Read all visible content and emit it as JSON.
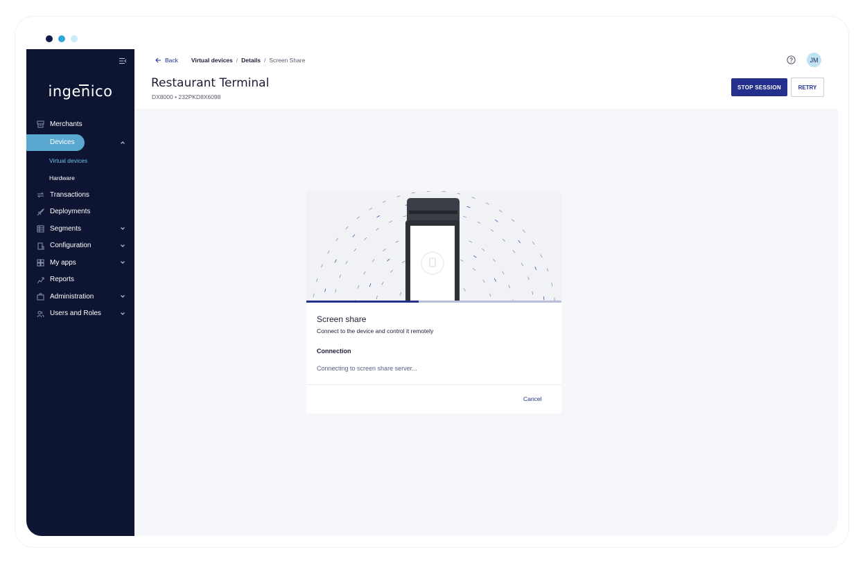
{
  "window": {
    "dots": [
      "#0d1a4a",
      "#2fa6db",
      "#c9ecf8"
    ]
  },
  "sidebar": {
    "logo": "ingenico",
    "items": [
      {
        "label": "Merchants",
        "icon": "store-icon",
        "expandable": false
      },
      {
        "label": "Devices",
        "icon": "device-icon",
        "expandable": true,
        "expanded": true,
        "active": true
      },
      {
        "label": "Transactions",
        "icon": "transfer-icon",
        "expandable": false
      },
      {
        "label": "Deployments",
        "icon": "rocket-icon",
        "expandable": false
      },
      {
        "label": "Segments",
        "icon": "segments-icon",
        "expandable": true
      },
      {
        "label": "Configuration",
        "icon": "configuration-icon",
        "expandable": true
      },
      {
        "label": "My apps",
        "icon": "apps-icon",
        "expandable": true
      },
      {
        "label": "Reports",
        "icon": "chart-icon",
        "expandable": false
      },
      {
        "label": "Administration",
        "icon": "briefcase-icon",
        "expandable": true
      },
      {
        "label": "Users and Roles",
        "icon": "users-icon",
        "expandable": true
      }
    ],
    "device_subitems": [
      {
        "label": "Virtual devices",
        "current": true
      },
      {
        "label": "Hardware",
        "current": false
      }
    ]
  },
  "header": {
    "back_label": "Back",
    "breadcrumb": [
      "Virtual devices",
      "Details",
      "Screen Share"
    ],
    "title": "Restaurant Terminal",
    "subtitle": "DX8000 • 232PKD8X6098",
    "avatar_initials": "JM",
    "stop_label": "STOP SESSION",
    "retry_label": "RETRY"
  },
  "dialog": {
    "title": "Screen share",
    "description": "Connect to the device and control it remotely",
    "connection_label": "Connection",
    "connection_status": "Connecting to screen share server...",
    "cancel_label": "Cancel",
    "progress": 0.44
  },
  "colors": {
    "sidebar": "#0e1532",
    "accent": "#23308c",
    "active_pill": "#5aa7cf",
    "subitem_active": "#6cc3e8"
  }
}
